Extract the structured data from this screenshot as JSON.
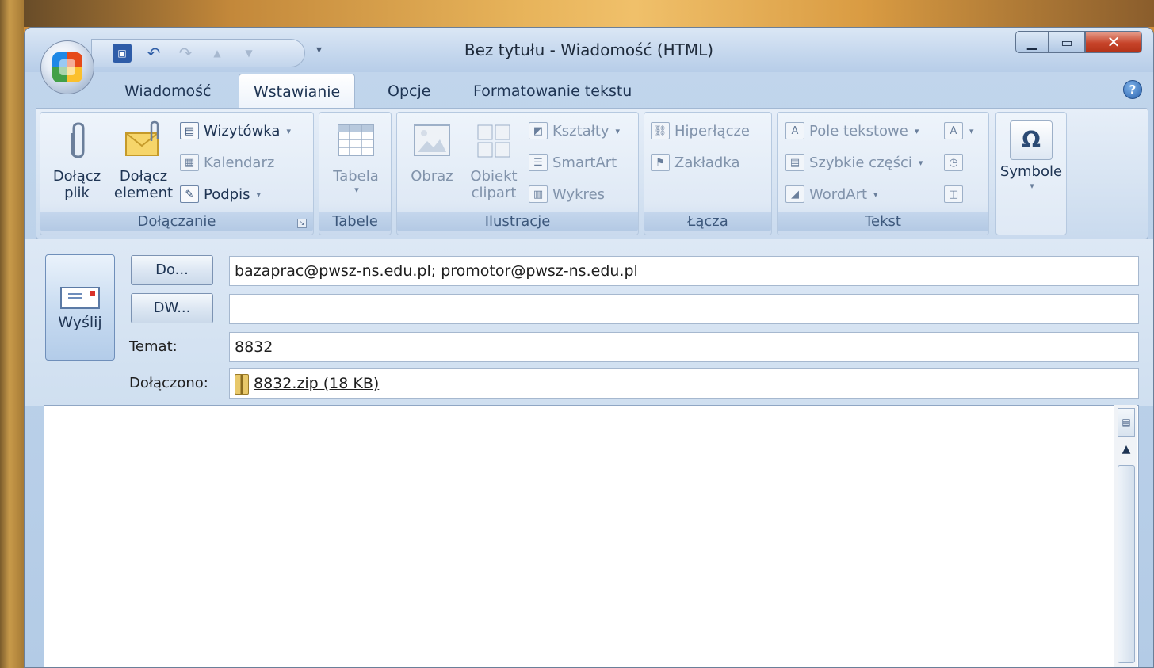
{
  "window": {
    "title": "Bez tytułu - Wiadomość (HTML)",
    "controls": {
      "minimize": "▁",
      "maximize": "▭",
      "close": "✕"
    }
  },
  "quick_access": {
    "icons": [
      "save-icon",
      "undo-icon",
      "redo-icon",
      "up-icon",
      "down-icon"
    ],
    "undo_glyph": "↶",
    "redo_glyph": "↷",
    "up_glyph": "▲",
    "down_glyph": "▼",
    "dropdown_glyph": "▾"
  },
  "tabs": [
    {
      "label": "Wiadomość",
      "active": false
    },
    {
      "label": "Wstawianie",
      "active": true
    },
    {
      "label": "Opcje",
      "active": false
    },
    {
      "label": "Formatowanie tekstu",
      "active": false
    }
  ],
  "help_glyph": "?",
  "ribbon": {
    "groups": {
      "dolaczanie": {
        "label": "Dołączanie",
        "attach_file": "Dołącz\nplik",
        "attach_file_l1": "Dołącz",
        "attach_file_l2": "plik",
        "attach_item_l1": "Dołącz",
        "attach_item_l2": "element",
        "business_card": "Wizytówka",
        "calendar": "Kalendarz",
        "signature": "Podpis"
      },
      "tabele": {
        "label": "Tabele",
        "table": "Tabela"
      },
      "ilustracje": {
        "label": "Ilustracje",
        "picture": "Obraz",
        "clipart_l1": "Obiekt",
        "clipart_l2": "clipart",
        "shapes": "Kształty",
        "smartart": "SmartArt",
        "chart": "Wykres"
      },
      "lacza": {
        "label": "Łącza",
        "hyperlink": "Hiperłącze",
        "bookmark": "Zakładka"
      },
      "tekst": {
        "label": "Tekst",
        "text_box": "Pole tekstowe",
        "quick_parts": "Szybkie części",
        "wordart": "WordArt"
      },
      "symbole": {
        "label": "Symbole",
        "glyph": "Ω"
      }
    }
  },
  "header": {
    "send": "Wyślij",
    "to_button": "Do...",
    "cc_button": "DW...",
    "to_value_1": "bazaprac@pwsz-ns.edu.pl",
    "to_separator": "; ",
    "to_value_2": "promotor@pwsz-ns.edu.pl",
    "cc_value": "",
    "subject_label": "Temat:",
    "subject_value": "8832",
    "attached_label": "Dołączono:",
    "attachment": "8832.zip (18 KB)"
  },
  "colors": {
    "ribbon_bg": "#d6e3f2",
    "close_button": "#c7442a",
    "tab_text": "#1e3453"
  }
}
